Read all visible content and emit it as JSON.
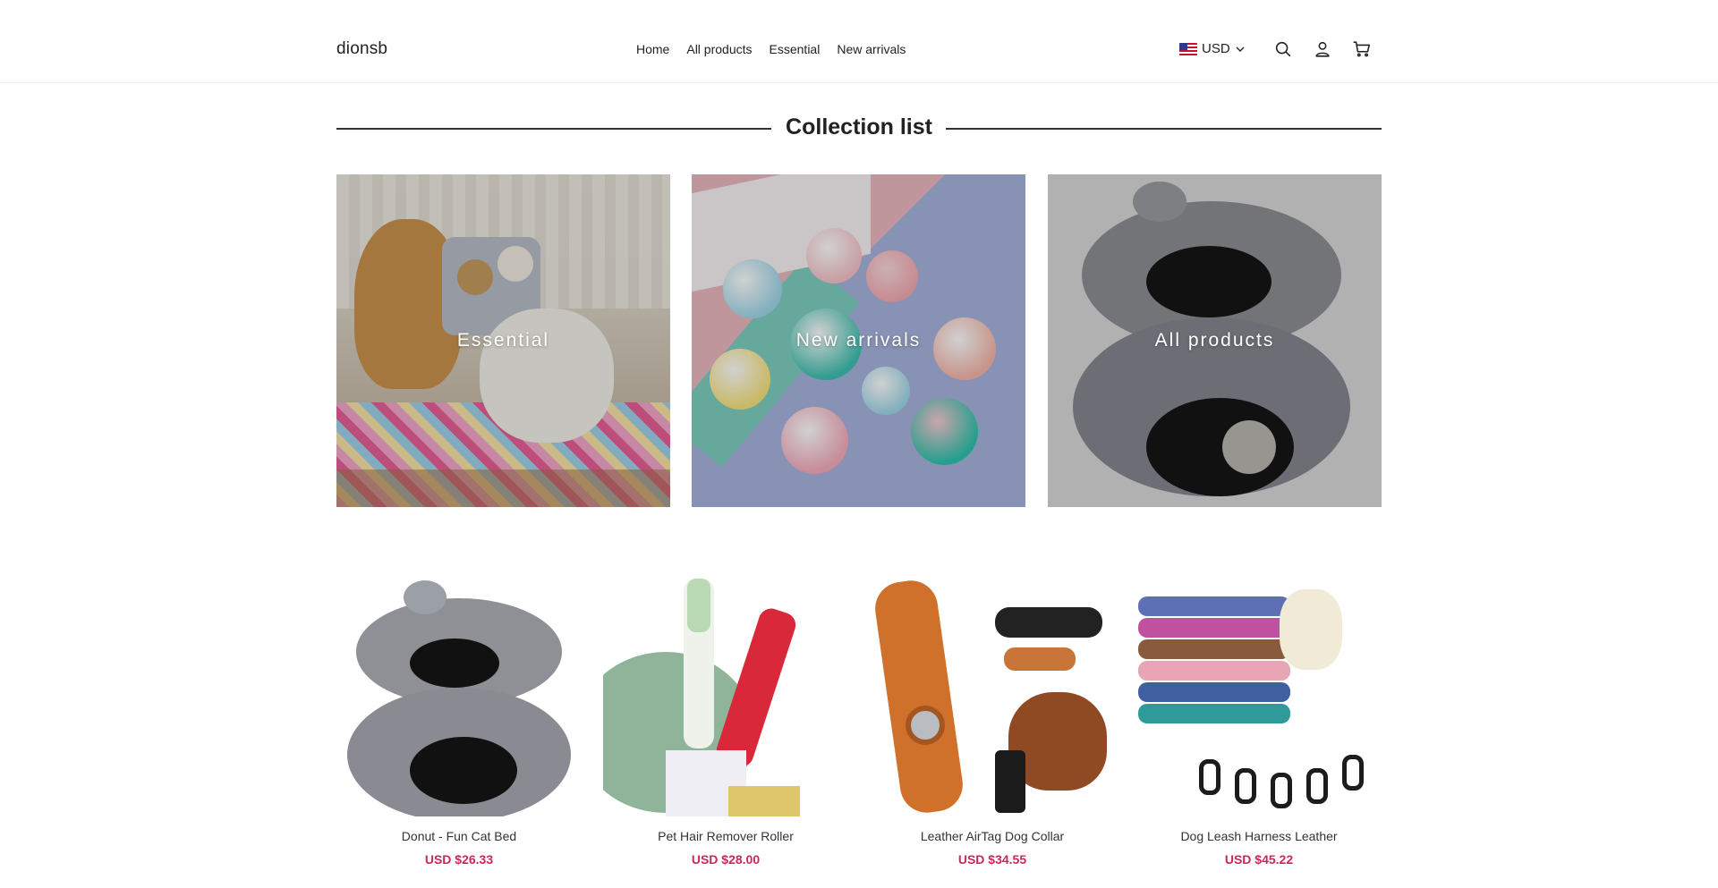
{
  "header": {
    "logo": "dionsb",
    "nav": [
      "Home",
      "All products",
      "Essential",
      "New arrivals"
    ],
    "currency": "USD",
    "icons": [
      "search-icon",
      "account-icon",
      "cart-icon"
    ]
  },
  "collections": {
    "title": "Collection list",
    "items": [
      {
        "label": "Essential"
      },
      {
        "label": "New arrivals"
      },
      {
        "label": "All products"
      }
    ]
  },
  "products": [
    {
      "title": "Donut - Fun Cat Bed",
      "price": "USD $26.33"
    },
    {
      "title": "Pet Hair Remover Roller",
      "price": "USD $28.00"
    },
    {
      "title": "Leather AirTag Dog Collar",
      "price": "USD $34.55"
    },
    {
      "title": "Dog Leash Harness Leather",
      "price": "USD $45.22"
    }
  ],
  "colors": {
    "price": "#c8285b",
    "text": "#222222",
    "divider": "#333333"
  }
}
